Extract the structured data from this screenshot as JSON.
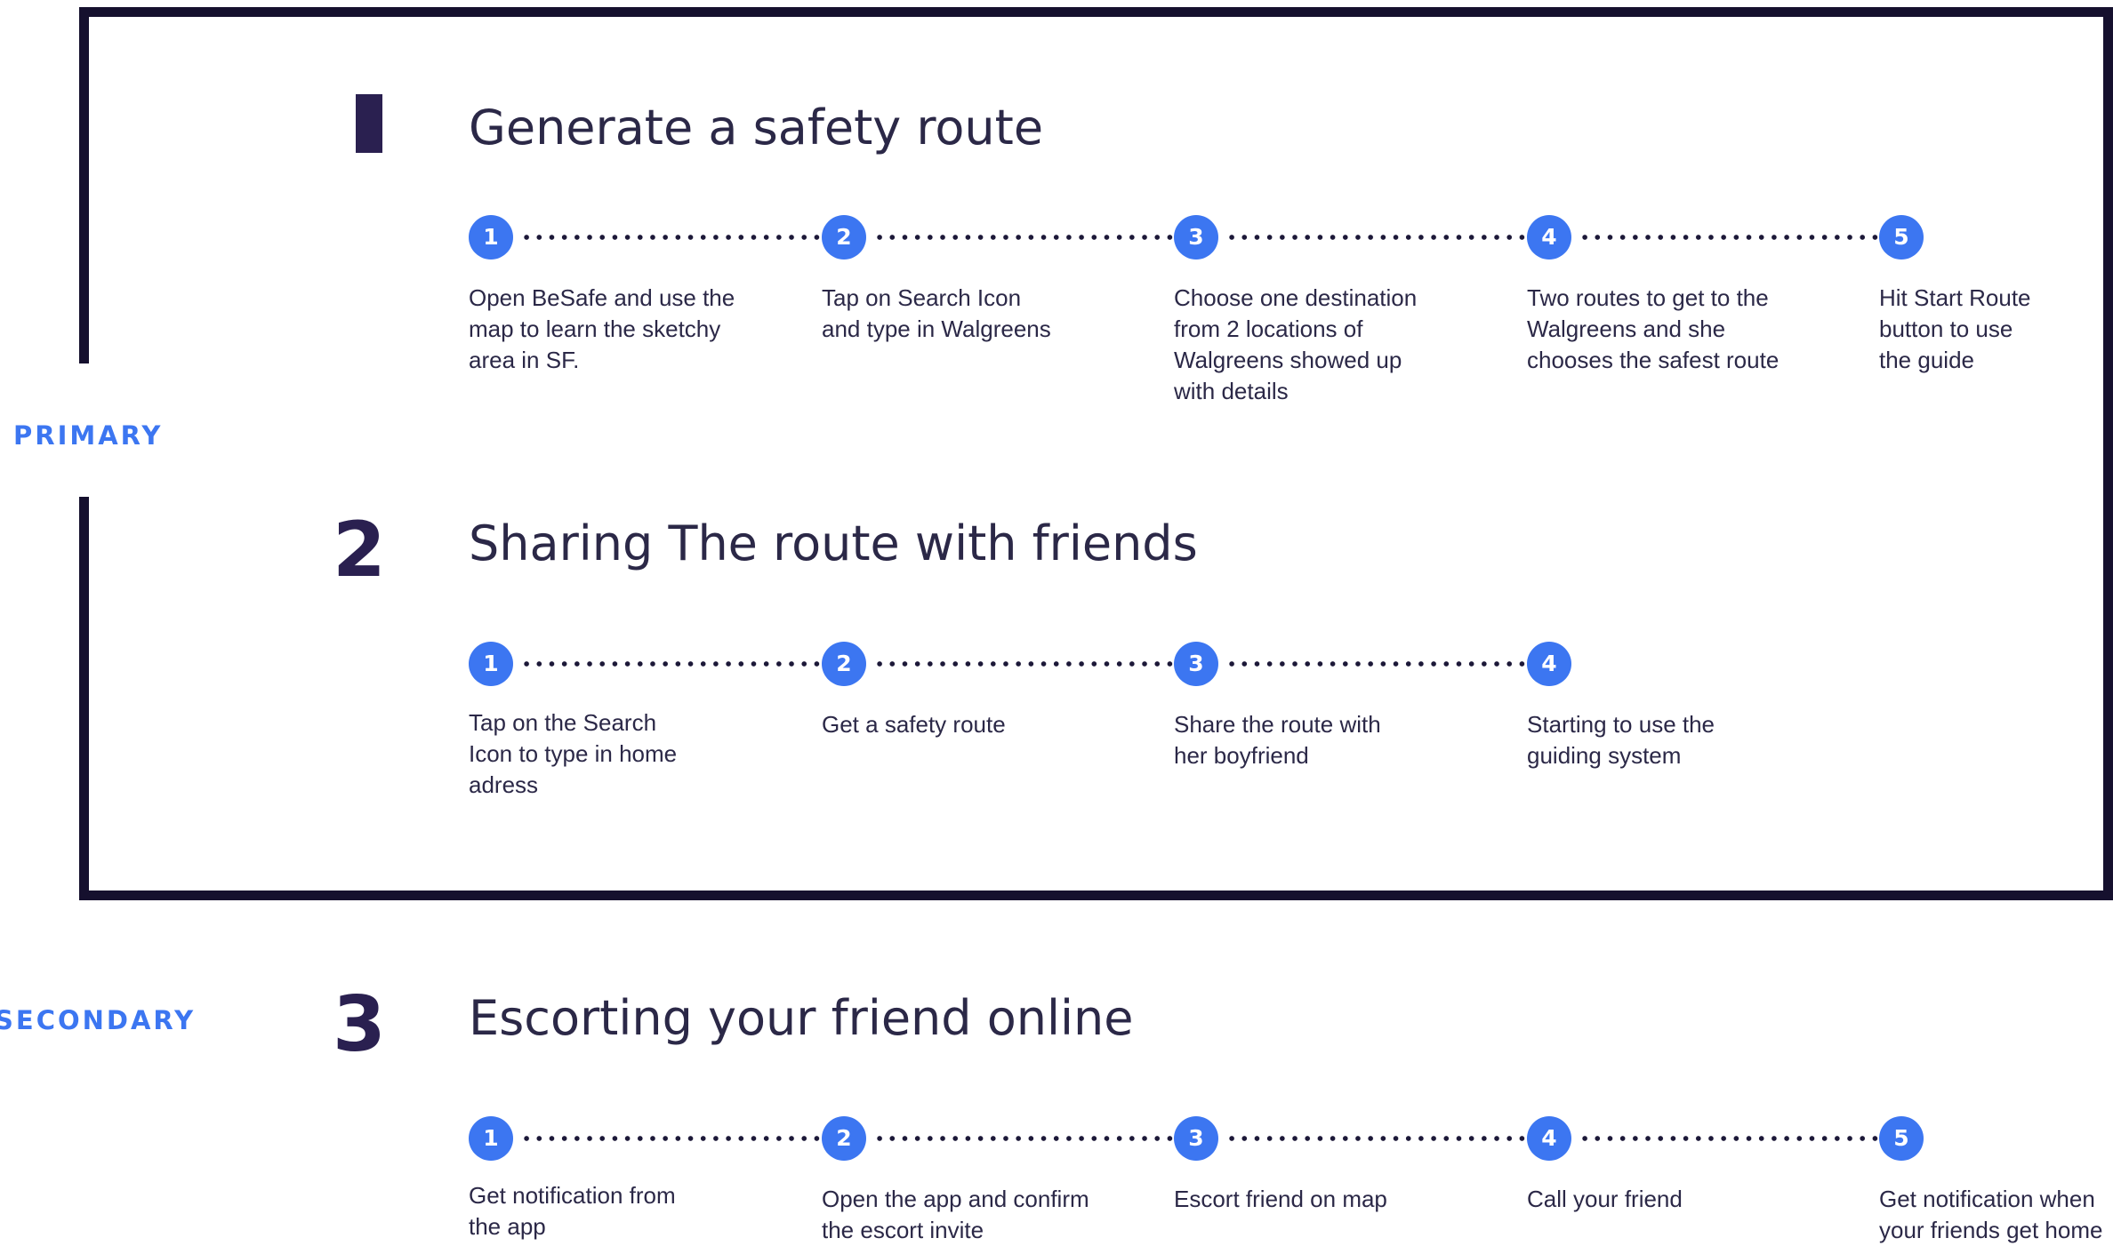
{
  "groups": {
    "primary": "PRIMARY",
    "secondary": "SECONDARY"
  },
  "sections": [
    {
      "number": "1",
      "title": "Generate a safety route",
      "steps": [
        {
          "n": "1",
          "text": "Open BeSafe and use the\nmap to learn the sketchy\narea in SF."
        },
        {
          "n": "2",
          "text": "Tap on Search Icon\nand type in Walgreens"
        },
        {
          "n": "3",
          "text": "Choose one destination\nfrom 2 locations of\nWalgreens showed up\nwith details"
        },
        {
          "n": "4",
          "text": "Two routes to get to the\nWalgreens and she\nchooses the safest route"
        },
        {
          "n": "5",
          "text": "Hit Start Route\nbutton to use\nthe guide"
        }
      ]
    },
    {
      "number": "2",
      "title": "Sharing The route with friends",
      "steps": [
        {
          "n": "1",
          "text": "Tap on the Search\nIcon to type in home\nadress"
        },
        {
          "n": "2",
          "text": "Get a safety route"
        },
        {
          "n": "3",
          "text": "Share the route with\nher boyfriend"
        },
        {
          "n": "4",
          "text": "Starting to use the\nguiding system"
        }
      ]
    },
    {
      "number": "3",
      "title": "Escorting your friend online",
      "steps": [
        {
          "n": "1",
          "text": "Get notification from\nthe app"
        },
        {
          "n": "2",
          "text": "Open the app and confirm\nthe escort invite"
        },
        {
          "n": "3",
          "text": "Escort friend on map"
        },
        {
          "n": "4",
          "text": "Call your friend"
        },
        {
          "n": "5",
          "text": "Get notification when\nyour friends get home"
        }
      ]
    }
  ],
  "colors": {
    "accent": "#3c76f1",
    "frame": "#15102e",
    "heading": "#2a2050",
    "text": "#2b2847"
  }
}
